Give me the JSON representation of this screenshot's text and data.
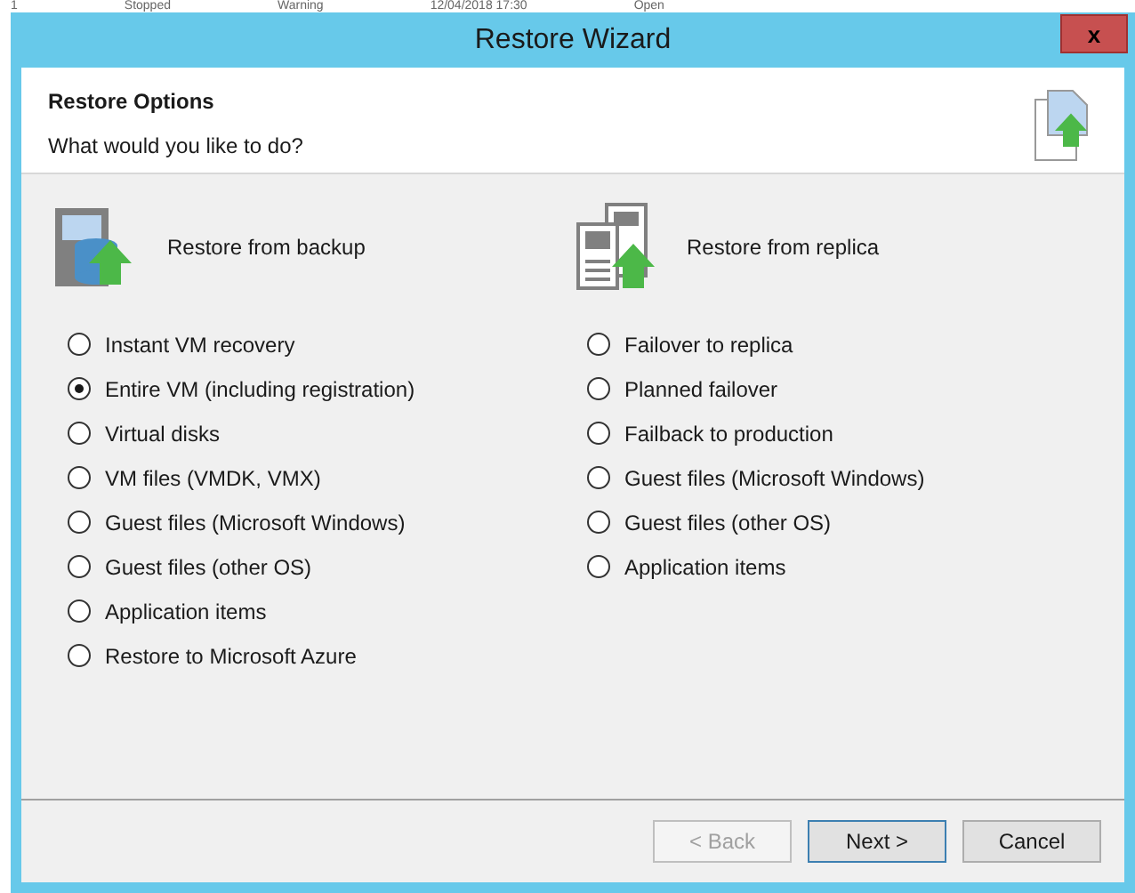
{
  "background_row": [
    "1",
    "Stopped",
    "Warning",
    "12/04/2018 17:30",
    "Open"
  ],
  "window": {
    "title": "Restore Wizard",
    "close": "x"
  },
  "header": {
    "title": "Restore Options",
    "subtitle": "What would you like to do?"
  },
  "groups": [
    {
      "title": "Restore from backup",
      "kind": "backup",
      "options": [
        {
          "label": "Instant VM recovery",
          "selected": false
        },
        {
          "label": "Entire VM (including registration)",
          "selected": true
        },
        {
          "label": "Virtual disks",
          "selected": false
        },
        {
          "label": "VM files (VMDK, VMX)",
          "selected": false
        },
        {
          "label": "Guest files (Microsoft Windows)",
          "selected": false
        },
        {
          "label": "Guest files (other OS)",
          "selected": false
        },
        {
          "label": "Application items",
          "selected": false
        },
        {
          "label": "Restore to Microsoft Azure",
          "selected": false
        }
      ]
    },
    {
      "title": "Restore from replica",
      "kind": "replica",
      "options": [
        {
          "label": "Failover to replica",
          "selected": false
        },
        {
          "label": "Planned failover",
          "selected": false
        },
        {
          "label": "Failback to production",
          "selected": false
        },
        {
          "label": "Guest files (Microsoft Windows)",
          "selected": false
        },
        {
          "label": "Guest files (other OS)",
          "selected": false
        },
        {
          "label": "Application items",
          "selected": false
        }
      ]
    }
  ],
  "buttons": [
    {
      "label": "< Back",
      "disabled": true,
      "selected": false
    },
    {
      "label": "Next >",
      "disabled": false,
      "selected": true
    },
    {
      "label": "Cancel",
      "disabled": false,
      "selected": false
    }
  ]
}
